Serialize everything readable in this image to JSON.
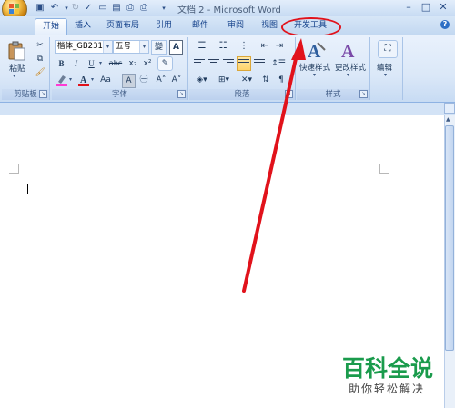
{
  "title_bar": {
    "title": "文档 2 - Microsoft Word",
    "qat_icons": [
      "save-icon",
      "undo-icon",
      "redo-icon",
      "spelling-icon",
      "new-doc-icon",
      "open-icon",
      "print-preview-icon",
      "customize-icon"
    ],
    "window_controls": [
      "minimize-icon",
      "maximize-icon",
      "close-icon"
    ]
  },
  "tabs": [
    {
      "label": "开始",
      "active": true
    },
    {
      "label": "插入"
    },
    {
      "label": "页面布局"
    },
    {
      "label": "引用"
    },
    {
      "label": "邮件"
    },
    {
      "label": "审阅"
    },
    {
      "label": "视图"
    },
    {
      "label": "开发工具",
      "highlighted": true
    }
  ],
  "ribbon": {
    "clipboard": {
      "paste_label": "粘贴",
      "group_label": "剪贴板"
    },
    "font": {
      "font_name": "楷体_GB2312",
      "font_size": "五号",
      "wen_glyph": "變",
      "a_glyph": "A",
      "bold": "B",
      "italic": "I",
      "underline": "U",
      "strike": "abc",
      "subscript": "x₂",
      "superscript": "x²",
      "change_case": "Aa",
      "char_border": "A",
      "phonetic": "㊀",
      "grow": "A˄",
      "shrink": "A˅",
      "group_label": "字体"
    },
    "paragraph": {
      "group_label": "段落"
    },
    "styles": {
      "quick_styles": "快速样式",
      "change_styles": "更改样式",
      "group_label": "样式"
    },
    "editing": {
      "label": "编辑"
    }
  },
  "watermark": {
    "title": "百科全说",
    "subtitle": "助你轻松解决"
  },
  "colors": {
    "annotation_red": "#e1121b",
    "watermark_green": "#1a9b4c"
  }
}
